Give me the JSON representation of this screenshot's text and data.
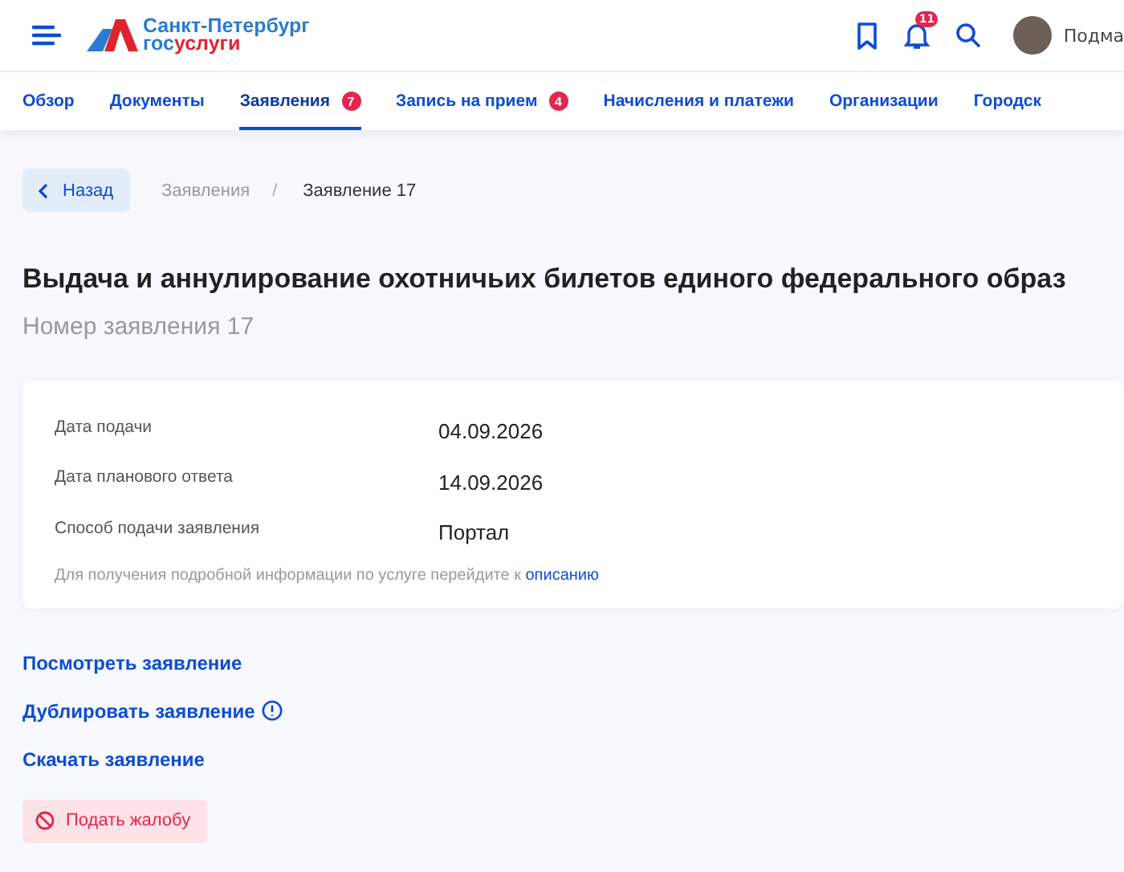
{
  "header": {
    "logo": {
      "city": "Санкт-Петербург",
      "brand_start": "гос",
      "brand_end": "услуги"
    },
    "notifications_badge": "11",
    "user_name": "Подма"
  },
  "tabs": [
    {
      "label": "Обзор",
      "selected": false
    },
    {
      "label": "Документы",
      "selected": false
    },
    {
      "label": "Заявления",
      "selected": true,
      "badge": "7"
    },
    {
      "label": "Запись на прием",
      "selected": false,
      "badge": "4"
    },
    {
      "label": "Начисления и платежи",
      "selected": false
    },
    {
      "label": "Организации",
      "selected": false
    },
    {
      "label": "Городск",
      "selected": false
    }
  ],
  "back_button": "Назад",
  "breadcrumbs": [
    "Заявления",
    "Заявление 17"
  ],
  "breadcrumb_separator": "/",
  "title": "Выдача и аннулирование охотничьих билетов единого федерального образ",
  "application_number": "Номер заявления 17",
  "details": [
    {
      "label": "Дата подачи",
      "value": "04.09.2026"
    },
    {
      "label": "Дата планового ответа",
      "value": "14.09.2026"
    },
    {
      "label": "Способ подачи заявления",
      "value": "Портал"
    }
  ],
  "info": {
    "text": "Для получения подробной информации по услуге перейдите к",
    "link": "описанию"
  },
  "actions": [
    {
      "label": "Посмотреть заявление",
      "info_icon": false
    },
    {
      "label": "Дублировать заявление",
      "info_icon": true
    },
    {
      "label": "Скачать заявление",
      "info_icon": false
    }
  ],
  "complaint_button": "Подать жалобу"
}
